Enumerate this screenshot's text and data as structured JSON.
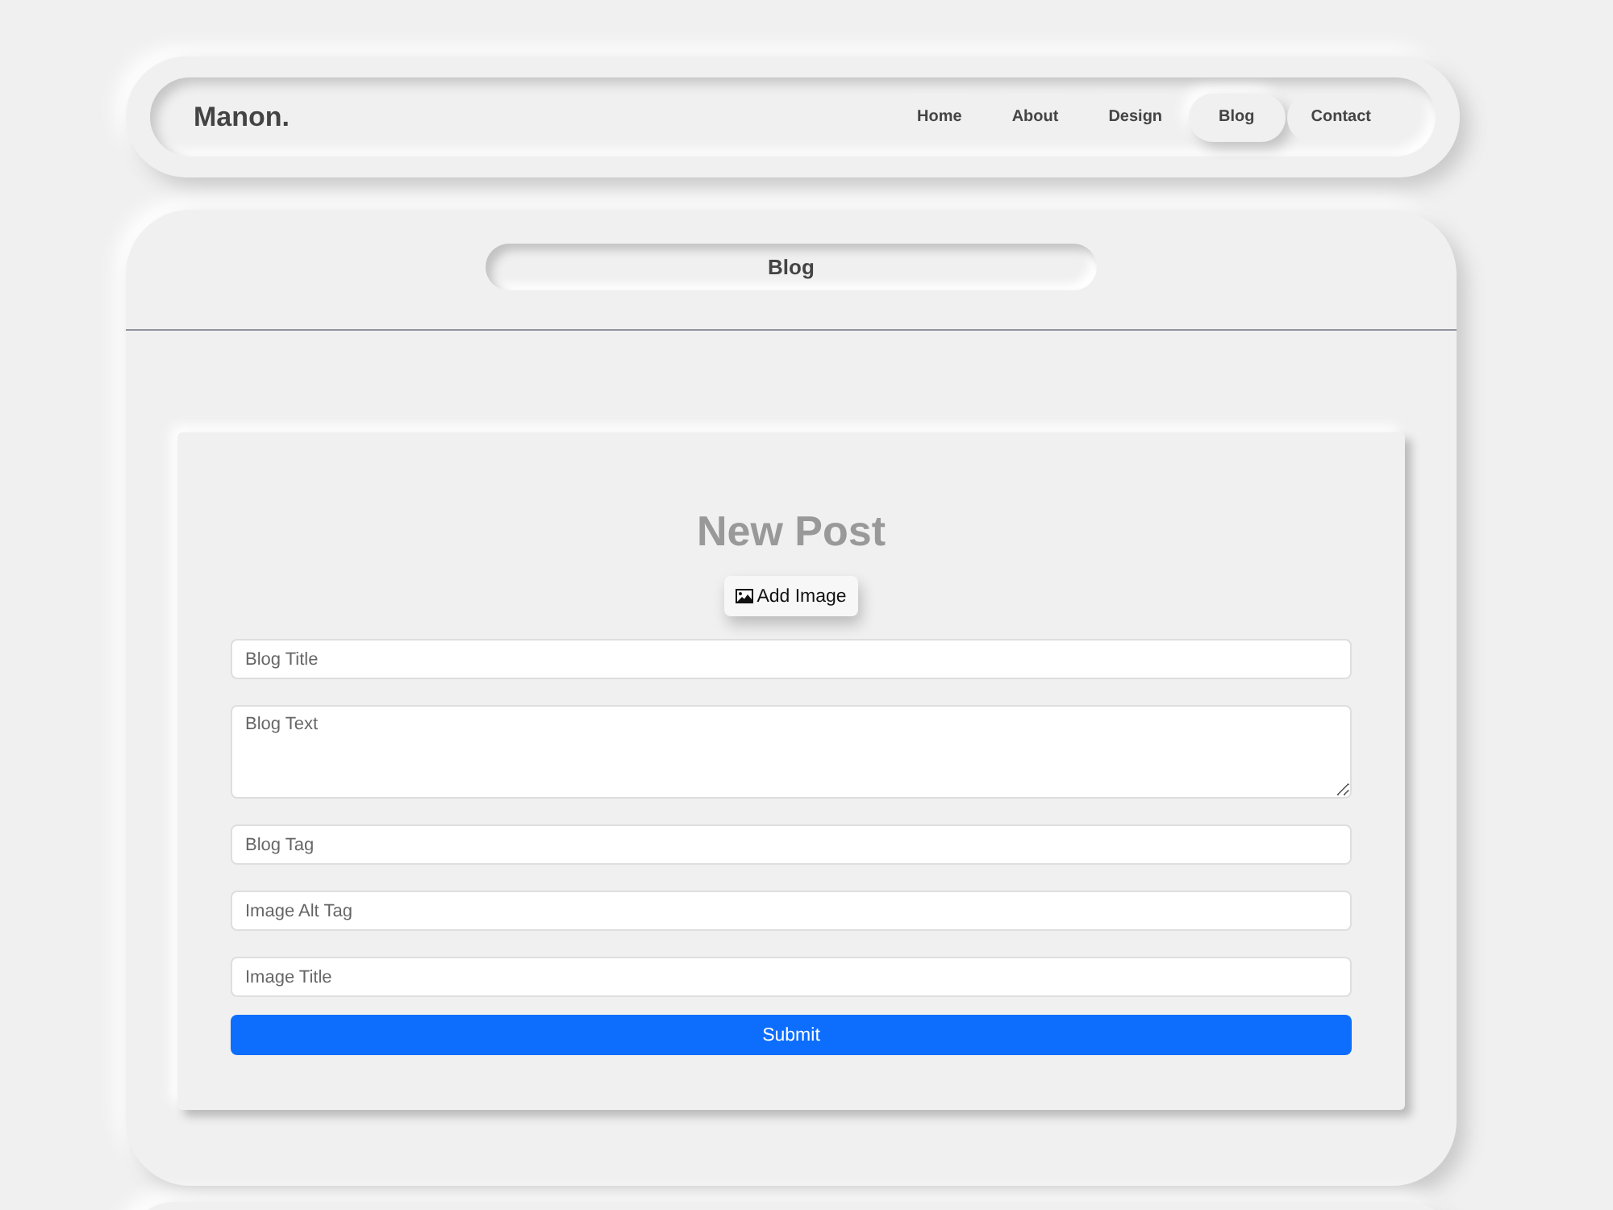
{
  "nav": {
    "logo": "Manon.",
    "items": [
      {
        "label": "Home",
        "selected": false
      },
      {
        "label": "About",
        "selected": false
      },
      {
        "label": "Design",
        "selected": false
      },
      {
        "label": "Blog",
        "selected": true
      },
      {
        "label": "Contact",
        "selected": false
      }
    ]
  },
  "section": {
    "title": "Blog"
  },
  "form": {
    "title": "New Post",
    "add_image_button": "Add Image",
    "fields": [
      {
        "kind": "input",
        "placeholder": "Blog Title"
      },
      {
        "kind": "textarea",
        "placeholder": "Blog Text"
      },
      {
        "kind": "input",
        "placeholder": "Blog Tag"
      },
      {
        "kind": "input",
        "placeholder": "Image Alt Tag"
      },
      {
        "kind": "input",
        "placeholder": "Image Title"
      }
    ],
    "submit_button": "Submit"
  }
}
